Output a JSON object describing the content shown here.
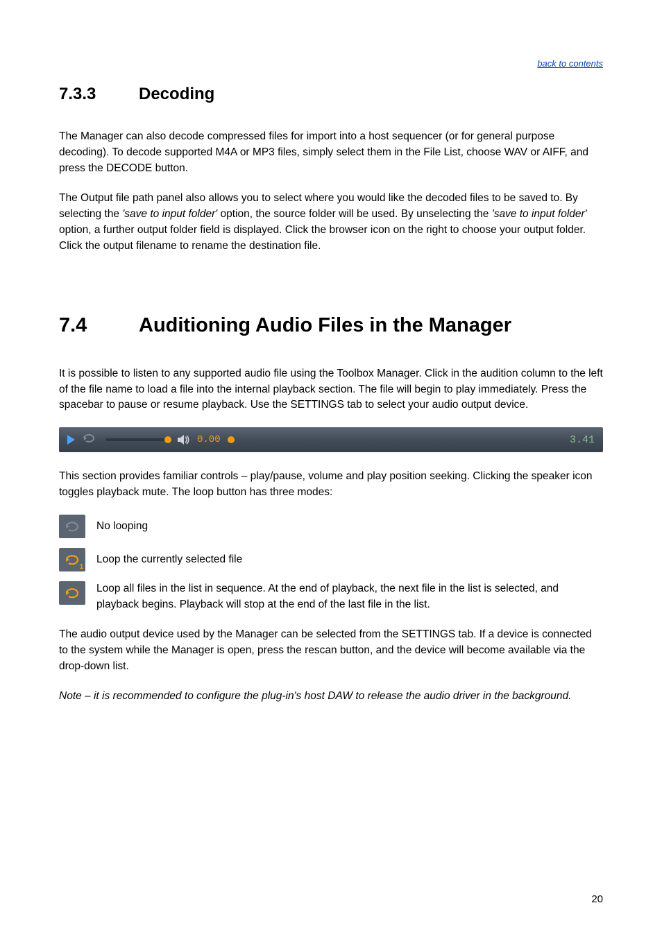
{
  "back_link": "back to contents",
  "section1": {
    "number": "7.3.3",
    "title": "Decoding"
  },
  "section1_para1": "The Manager can also decode compressed files for import into a host sequencer (or for general purpose decoding). To decode supported M4A or MP3 files, simply select them in the File List, choose WAV or AIFF, and press the DECODE button.",
  "section1_para2_a": "The Output file path panel also allows you to select where you would like the decoded files to be saved to. By selecting the ",
  "section1_para2_em1": "'save to input folder'",
  "section1_para2_b": " option, the source folder will be used. By unselecting the ",
  "section1_para2_em2": "'save to input folder'",
  "section1_para2_c": " option, a further output folder field is displayed. Click the browser icon on the right to choose your output folder. Click the output filename to rename the destination file.",
  "section2": {
    "number": "7.4",
    "title": "Auditioning Audio Files in the Manager"
  },
  "section2_para1": "It is possible to listen to any supported audio file using the Toolbox Manager. Click in the audition column to the left of the file name to load a file into the internal playback section. The file will begin to play immediately. Press the spacebar to pause or resume playback. Use the SETTINGS tab to select your audio output device.",
  "player": {
    "current_time": "0.00",
    "duration": "3.41"
  },
  "section2_para2": "This section provides familiar controls – play/pause, volume and play position seeking. Clicking the speaker icon toggles playback mute. The loop button has three modes:",
  "loop_modes": {
    "none": "No looping",
    "one": "Loop the currently selected file",
    "all": "Loop all files in the list in sequence. At the end of playback, the next file in the list is selected, and playback begins. Playback will stop at the end of the last file in the list."
  },
  "section2_para3": "The audio output device used by the Manager can be selected from the SETTINGS tab. If a device is connected to the system while the Manager is open, press the rescan button, and the device will become available via the drop-down list.",
  "section2_note": "Note – it is recommended to configure the plug-in's host DAW to release the audio driver in the background.",
  "page_number": "20"
}
